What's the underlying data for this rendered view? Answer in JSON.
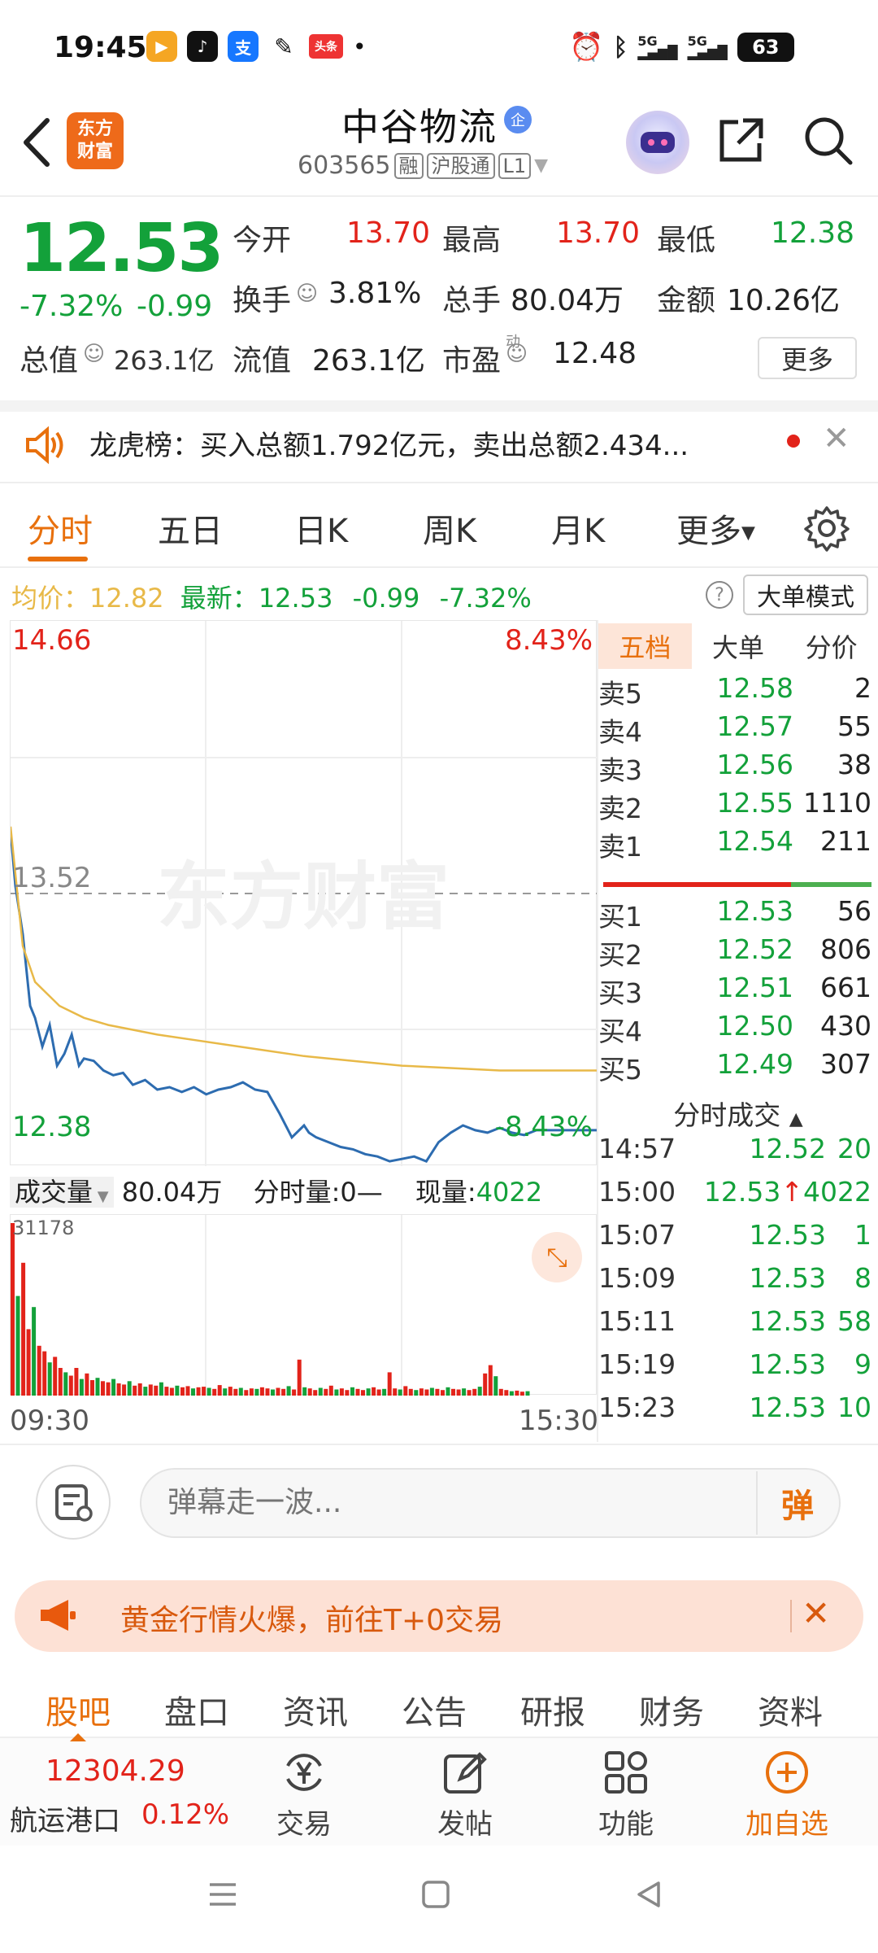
{
  "status_bar": {
    "time": "19:45",
    "battery": "63",
    "signal1": "5G",
    "signal2": "5G",
    "toutiao": "头条"
  },
  "header": {
    "logo_line1": "东方",
    "logo_line2": "财富",
    "stock_name": "中谷物流",
    "enterprise_badge": "企",
    "stock_code": "603565",
    "tag_margin": "融",
    "tag_connect": "沪股通",
    "tag_level": "L1"
  },
  "quote": {
    "price": "12.53",
    "change_pct": "-7.32%",
    "change_abs": "-0.99",
    "open_label": "今开",
    "open": "13.70",
    "high_label": "最高",
    "high": "13.70",
    "low_label": "最低",
    "low": "12.38",
    "turnover_label": "换手",
    "turnover": "3.81%",
    "volume_label": "总手",
    "volume": "80.04万",
    "amount_label": "金额",
    "amount": "10.26亿",
    "mktcap_label": "总值",
    "mktcap": "263.1亿",
    "float_label": "流值",
    "float_cap": "263.1亿",
    "pe_label": "市盈",
    "pe_sup": "动",
    "pe": "12.48",
    "more_label": "更多"
  },
  "notice": {
    "text": "龙虎榜：买入总额1.792亿元，卖出总额2.434..."
  },
  "chart_tabs": [
    "分时",
    "五日",
    "日K",
    "周K",
    "月K",
    "更多"
  ],
  "avg_row": {
    "avg_label": "均价：",
    "avg": "12.82",
    "latest_label": "最新：",
    "latest": "12.53",
    "chg": "-0.99",
    "pct": "-7.32%",
    "big_order_label": "大单模式"
  },
  "chart": {
    "top_price": "14.66",
    "top_pct": "8.43%",
    "mid_price": "13.52",
    "bottom_price": "12.38",
    "bottom_pct": "-8.43%",
    "watermark": "东方财富",
    "vol_label": "成交量",
    "vol_total": "80.04万",
    "period_vol": "分时量:0—",
    "now_vol_label": "现量:",
    "now_vol": "4022",
    "vol_max": "31178",
    "time_start": "09:30",
    "time_end": "15:30"
  },
  "chart_data": {
    "type": "line",
    "title": "",
    "xlabel": "",
    "ylabel": "",
    "ylim": [
      12.38,
      14.66
    ],
    "x_range": [
      "09:30",
      "15:30"
    ],
    "series": [
      {
        "name": "",
        "color": "#2d6cb0",
        "x": [
          0,
          2,
          5,
          8,
          10,
          13,
          16,
          19,
          22,
          25,
          28,
          30,
          34,
          38,
          42,
          46,
          50,
          55,
          60,
          65,
          70,
          75,
          80,
          85,
          90,
          95,
          100,
          105,
          110,
          115,
          120,
          122,
          125,
          130,
          135,
          140,
          145,
          150,
          155,
          160,
          165,
          170,
          175,
          180,
          185,
          190,
          195,
          200,
          205,
          210,
          215,
          220,
          225,
          230,
          235,
          240
        ],
        "y": [
          13.78,
          13.55,
          13.35,
          13.05,
          13.0,
          12.88,
          12.97,
          12.8,
          12.85,
          12.93,
          12.8,
          12.83,
          12.82,
          12.78,
          12.76,
          12.77,
          12.72,
          12.74,
          12.7,
          12.71,
          12.69,
          12.71,
          12.68,
          12.7,
          12.71,
          12.73,
          12.7,
          12.69,
          12.6,
          12.5,
          12.55,
          12.52,
          12.5,
          12.48,
          12.46,
          12.45,
          12.43,
          12.42,
          12.4,
          12.41,
          12.42,
          12.4,
          12.48,
          12.52,
          12.55,
          12.53,
          12.52,
          12.54,
          12.52,
          12.51,
          12.53,
          12.53,
          12.53,
          12.53,
          12.53,
          12.53
        ]
      },
      {
        "name": "",
        "color": "#e8b948",
        "x": [
          0,
          5,
          10,
          20,
          30,
          40,
          60,
          80,
          100,
          120,
          140,
          160,
          180,
          200,
          220,
          240
        ],
        "y": [
          13.8,
          13.3,
          13.15,
          13.05,
          13.0,
          12.97,
          12.93,
          12.9,
          12.87,
          12.84,
          12.82,
          12.8,
          12.79,
          12.78,
          12.78,
          12.78
        ]
      }
    ],
    "volume": {
      "max": 31178,
      "values": [
        31178,
        18000,
        24000,
        12000,
        16000,
        9000,
        8000,
        6000,
        7000,
        5000,
        4200,
        3600,
        5000,
        3000,
        4000,
        2800,
        3200,
        2600,
        2400,
        3000,
        2200,
        2000,
        2600,
        1800,
        2200,
        1600,
        2000,
        1800,
        2400,
        1600,
        1400,
        1800,
        1500,
        1700,
        1300,
        1500,
        1600,
        1400,
        1200,
        1900,
        1300,
        1600,
        1200,
        1400,
        1000,
        1300,
        1200,
        1500,
        1300,
        1100,
        1400,
        1200,
        1700,
        1100,
        6500,
        1500,
        1300,
        1000,
        1400,
        1200,
        1800,
        1100,
        1300,
        1000,
        1500,
        1200,
        1000,
        1300,
        1500,
        1100,
        1200,
        4200,
        1300,
        1100,
        1700,
        1200,
        1000,
        1300,
        1100,
        1400,
        1200,
        1000,
        1500,
        1200,
        1100,
        1300,
        1000,
        1200,
        1600,
        4000,
        5500,
        3500,
        1200,
        1000,
        800,
        900,
        700,
        800
      ]
    }
  },
  "order_book": {
    "tabs": [
      "五档",
      "大单",
      "分价"
    ],
    "asks": [
      {
        "label": "卖5",
        "price": "12.58",
        "vol": "2"
      },
      {
        "label": "卖4",
        "price": "12.57",
        "vol": "55"
      },
      {
        "label": "卖3",
        "price": "12.56",
        "vol": "38"
      },
      {
        "label": "卖2",
        "price": "12.55",
        "vol": "1110"
      },
      {
        "label": "卖1",
        "price": "12.54",
        "vol": "211"
      }
    ],
    "bids": [
      {
        "label": "买1",
        "price": "12.53",
        "vol": "56"
      },
      {
        "label": "买2",
        "price": "12.52",
        "vol": "806"
      },
      {
        "label": "买3",
        "price": "12.51",
        "vol": "661"
      },
      {
        "label": "买4",
        "price": "12.50",
        "vol": "430"
      },
      {
        "label": "买5",
        "price": "12.49",
        "vol": "307"
      }
    ],
    "trades_header": "分时成交",
    "trades": [
      {
        "time": "14:57",
        "price": "12.52",
        "vol": "20"
      },
      {
        "time": "15:00",
        "price": "12.53",
        "vol": "4022",
        "arrow": "↑"
      },
      {
        "time": "15:07",
        "price": "12.53",
        "vol": "1"
      },
      {
        "time": "15:09",
        "price": "12.53",
        "vol": "8"
      },
      {
        "time": "15:11",
        "price": "12.53",
        "vol": "58"
      },
      {
        "time": "15:19",
        "price": "12.53",
        "vol": "9"
      },
      {
        "time": "15:23",
        "price": "12.53",
        "vol": "10"
      }
    ]
  },
  "comment_bar": {
    "placeholder": "弹幕走一波...",
    "send_label": "弹"
  },
  "promo": {
    "text": "黄金行情火爆，前往T+0交易"
  },
  "sub_tabs": [
    "股吧",
    "盘口",
    "资讯",
    "公告",
    "研报",
    "财务",
    "资料"
  ],
  "bottom_bar": {
    "index_value": "12304.29",
    "index_name": "航运港口",
    "index_change": "0.12%",
    "trade_label": "交易",
    "post_label": "发帖",
    "function_label": "功能",
    "watchlist_label": "加自选"
  },
  "colors": {
    "rise": "#e2231a",
    "fall": "#13a13a",
    "accent": "#e8700d"
  }
}
